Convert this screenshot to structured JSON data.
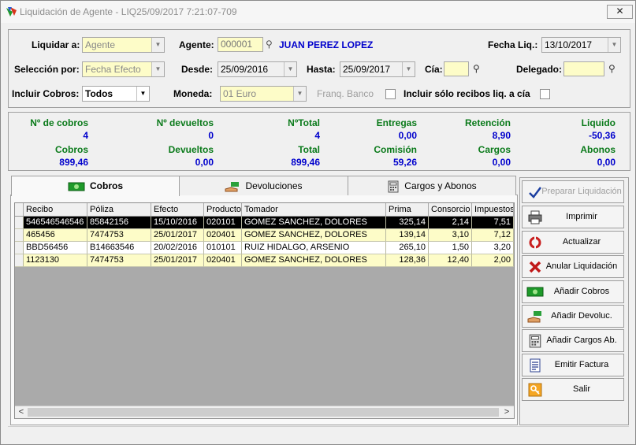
{
  "window": {
    "title": "Liquidación de Agente - LIQ25/09/2017 7:21:07-709",
    "close_glyph": "✕"
  },
  "form": {
    "liquidar_label": "Liquidar a:",
    "liquidar_value": "Agente",
    "agente_label": "Agente:",
    "agente_code": "000001",
    "agente_name": "JUAN PEREZ LOPEZ",
    "fecha_liq_label": "Fecha Liq.:",
    "fecha_liq_value": "13/10/2017",
    "seleccion_label": "Selección por:",
    "seleccion_value": "Fecha Efecto",
    "desde_label": "Desde:",
    "desde_value": "25/09/2016",
    "hasta_label": "Hasta:",
    "hasta_value": "25/09/2017",
    "cia_label": "Cía:",
    "cia_value": "",
    "delegado_label": "Delegado:",
    "delegado_value": "",
    "incluir_cobros_label": "Incluir Cobros:",
    "incluir_cobros_value": "Todos",
    "moneda_label": "Moneda:",
    "moneda_value": "01 Euro",
    "franq_banco_label": "Franq. Banco",
    "incluir_solo_label": "Incluir sólo recibos liq. a cía"
  },
  "summary": {
    "n_cobros_label": "Nº de cobros",
    "n_cobros": "4",
    "n_devueltos_label": "Nº devueltos",
    "n_devueltos": "0",
    "n_total_label": "NºTotal",
    "n_total": "4",
    "entregas_label": "Entregas",
    "entregas": "0,00",
    "retencion_label": "Retención",
    "retencion": "8,90",
    "liquido_label": "Liquido",
    "liquido": "-50,36",
    "cobros_label": "Cobros",
    "cobros": "899,46",
    "devueltos_label": "Devueltos",
    "devueltos": "0,00",
    "total_label": "Total",
    "total": "899,46",
    "comision_label": "Comisión",
    "comision": "59,26",
    "cargos_label": "Cargos",
    "cargos": "0,00",
    "abonos_label": "Abonos",
    "abonos": "0,00"
  },
  "tabs": [
    {
      "label": "Cobros",
      "icon": "money-icon"
    },
    {
      "label": "Devoluciones",
      "icon": "hand-money-icon"
    },
    {
      "label": "Cargos y Abonos",
      "icon": "calculator-icon"
    }
  ],
  "grid": {
    "headers": [
      "Recibo",
      "Póliza",
      "Efecto",
      "Producto",
      "Tomador",
      "Prima",
      "Consorcio",
      "Impuestos"
    ],
    "rows": [
      [
        "546546546546",
        "85842156",
        "15/10/2016",
        "020101",
        "GOMEZ SANCHEZ, DOLORES",
        "325,14",
        "2,14",
        "7,51"
      ],
      [
        "465456",
        "7474753",
        "25/01/2017",
        "020401",
        "GOMEZ SANCHEZ, DOLORES",
        "139,14",
        "3,10",
        "7,12"
      ],
      [
        "BBD56456",
        "B14663546",
        "20/02/2016",
        "010101",
        "RUIZ HIDALGO, ARSENIO",
        "265,10",
        "1,50",
        "3,20"
      ],
      [
        "1123130",
        "7474753",
        "25/01/2017",
        "020401",
        "GOMEZ SANCHEZ, DOLORES",
        "128,36",
        "12,40",
        "2,00"
      ]
    ],
    "selected_row": 0,
    "scroll_left": "<",
    "scroll_right": ">"
  },
  "actions": [
    {
      "label": "Preparar Liquidación",
      "icon": "checkmark-icon",
      "enabled": false
    },
    {
      "label": "Imprimir",
      "icon": "printer-icon",
      "enabled": true
    },
    {
      "label": "Actualizar",
      "icon": "refresh-icon",
      "enabled": true
    },
    {
      "label": "Anular Liquidación",
      "icon": "cross-icon",
      "enabled": true
    },
    {
      "label": "Añadir Cobros",
      "icon": "money-icon",
      "enabled": true
    },
    {
      "label": "Añadir Devoluc.",
      "icon": "hand-money-icon",
      "enabled": true
    },
    {
      "label": "Añadir Cargos Ab.",
      "icon": "calculator-icon",
      "enabled": true
    },
    {
      "label": "Emitir Factura",
      "icon": "invoice-icon",
      "enabled": true
    },
    {
      "label": "Salir",
      "icon": "key-icon",
      "enabled": true
    }
  ],
  "colors": {
    "row_yellow": "#fdfcc8",
    "selected_row": "#000000",
    "stat_label": "#0a7a1a",
    "stat_value": "#0000cc"
  }
}
